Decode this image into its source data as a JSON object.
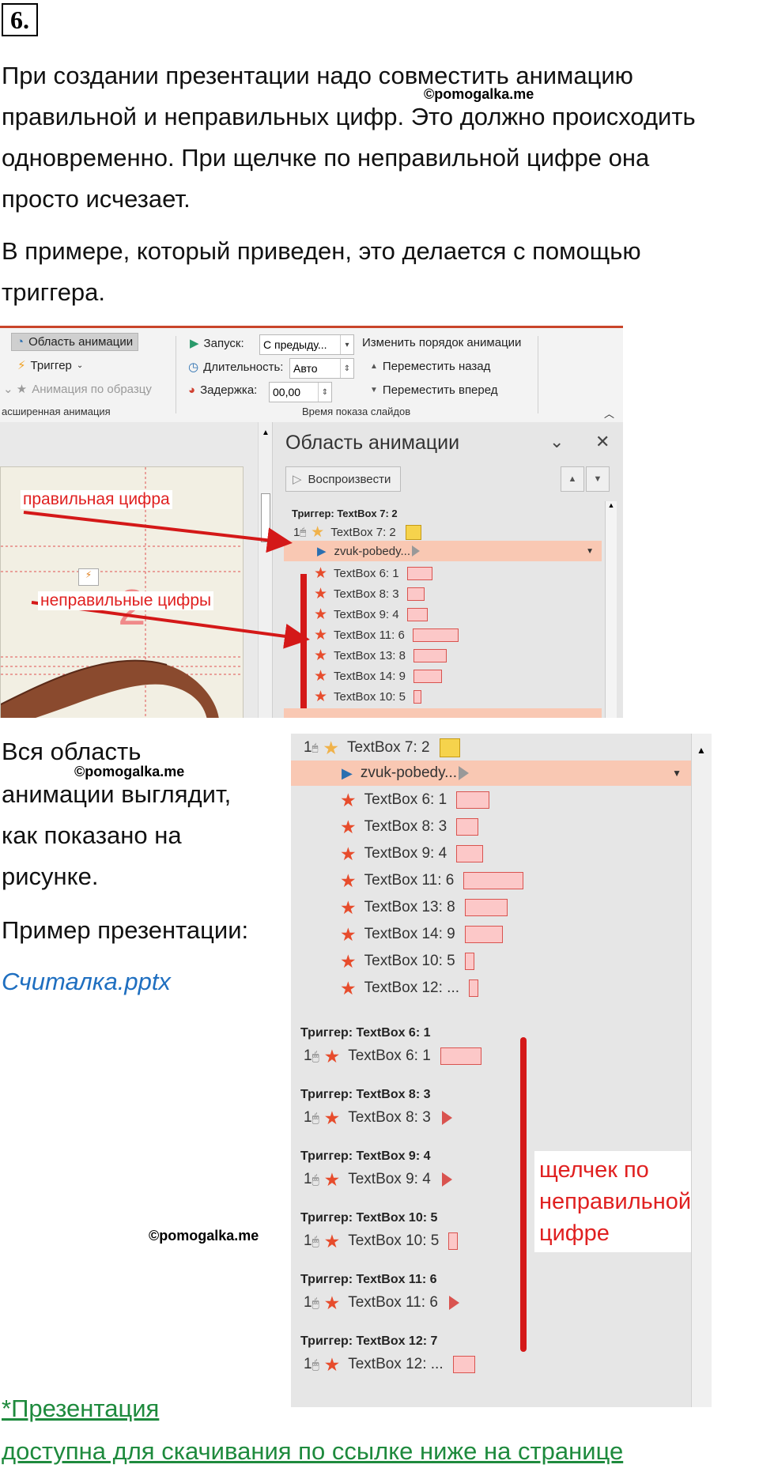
{
  "task": {
    "number": "6."
  },
  "watermark": "©pomogalka.me",
  "intro": {
    "lines": [
      "При создании презентации надо совместить анимацию",
      "правильной и неправильных цифр. Это должно происходить",
      "одновременно. При щелчке по неправильной цифре она",
      "просто исчезает."
    ],
    "lines2": [
      "В примере, который приведен, это делается с помощью",
      "триггера."
    ]
  },
  "ribbon": {
    "anim_pane_btn": "Область анимации",
    "trigger_btn": "Триггер",
    "painter_btn": "Анимация по образцу",
    "group1": "асширенная анимация",
    "start_label": "Запуск:",
    "start_value": "С предыду...",
    "duration_label": "Длительность:",
    "duration_value": "Авто",
    "delay_label": "Задержка:",
    "delay_value": "00,00",
    "reorder_title": "Изменить порядок анимации",
    "move_back": "Переместить назад",
    "move_forward": "Переместить вперед",
    "group2": "Время показа слайдов"
  },
  "slide": {
    "digit": "2"
  },
  "pane": {
    "title": "Область анимации",
    "play": "Воспроизвести",
    "trigger1": "Триггер: TextBox 7: 2",
    "num": "1",
    "rows": [
      {
        "label": "TextBox 7: 2"
      },
      {
        "label": "zvuk-pobedy..."
      },
      {
        "label": "TextBox 6: 1"
      },
      {
        "label": "TextBox 8: 3"
      },
      {
        "label": "TextBox 9: 4"
      },
      {
        "label": "TextBox 11: 6"
      },
      {
        "label": "TextBox 13: 8"
      },
      {
        "label": "TextBox 14: 9"
      },
      {
        "label": "TextBox 10: 5"
      }
    ]
  },
  "annotations": {
    "correct": "правильная цифра",
    "incorrect": "неправильные цифры",
    "click": [
      "щелчек по",
      "неправильной",
      "цифре"
    ]
  },
  "middle_text": {
    "lines": [
      "Вся область",
      "анимации выглядит,",
      "как показано на",
      "рисунке."
    ],
    "example": "Пример презентации:",
    "file_link": "Считалка.pptx"
  },
  "pane2": {
    "num": "1",
    "top_rows": [
      {
        "label": "TextBox 7: 2"
      },
      {
        "label": "zvuk-pobedy..."
      },
      {
        "label": "TextBox 6: 1"
      },
      {
        "label": "TextBox 8: 3"
      },
      {
        "label": "TextBox 9: 4"
      },
      {
        "label": "TextBox 11: 6"
      },
      {
        "label": "TextBox 13: 8"
      },
      {
        "label": "TextBox 14: 9"
      },
      {
        "label": "TextBox 10: 5"
      },
      {
        "label": "TextBox 12: ..."
      }
    ],
    "triggers": [
      {
        "title": "Триггер: TextBox 6: 1",
        "label": "TextBox 6: 1"
      },
      {
        "title": "Триггер: TextBox 8: 3",
        "label": "TextBox 8: 3"
      },
      {
        "title": "Триггер: TextBox 9: 4",
        "label": "TextBox 9: 4"
      },
      {
        "title": "Триггер: TextBox 10: 5",
        "label": "TextBox 10: 5"
      },
      {
        "title": "Триггер: TextBox 11: 6",
        "label": "TextBox 11: 6"
      },
      {
        "title": "Триггер: TextBox 12: 7",
        "label": "TextBox 12: ..."
      }
    ]
  },
  "footer": {
    "line1": "*Презентация",
    "line2": "доступна для скачивания по ссылке ниже на странице"
  }
}
